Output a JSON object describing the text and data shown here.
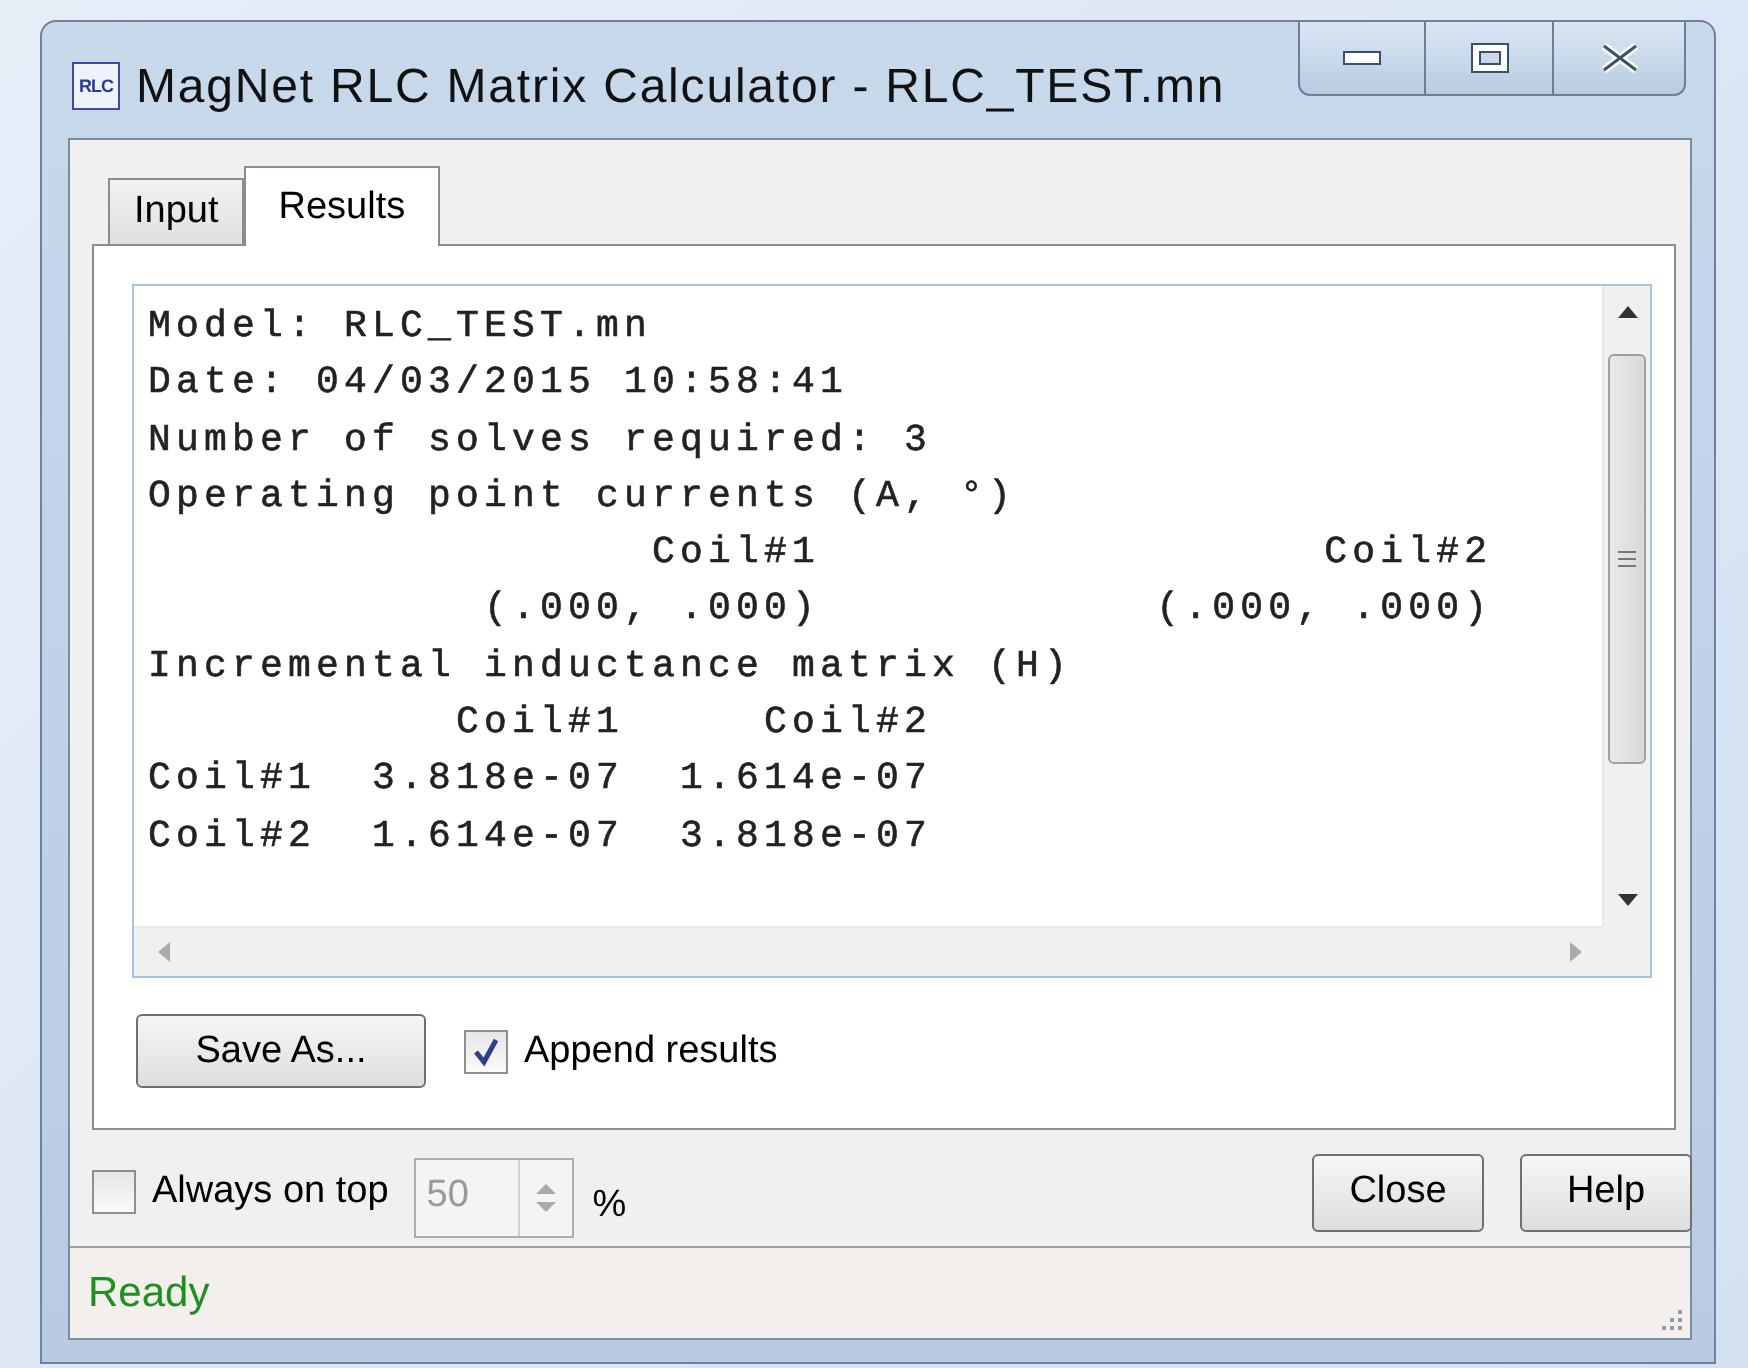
{
  "window": {
    "title": "MagNet RLC Matrix Calculator - RLC_TEST.mn",
    "icon_text": "RLC"
  },
  "tabs": [
    {
      "label": "Input",
      "selected": false
    },
    {
      "label": "Results",
      "selected": true
    }
  ],
  "results": {
    "lines": [
      "Model: RLC_TEST.mn",
      "Date: 04/03/2015 10:58:41",
      "Number of solves required: 3",
      "Operating point currents (A, °)",
      "                  Coil#1                  Coil#2",
      "            (.000, .000)            (.000, .000)",
      "Incremental inductance matrix (H)",
      "           Coil#1     Coil#2",
      "Coil#1  3.818e-07  1.614e-07",
      "Coil#2  1.614e-07  3.818e-07"
    ]
  },
  "save_button": "Save As...",
  "append_results": {
    "label": "Append results",
    "checked": true
  },
  "always_on_top": {
    "label": "Always on top",
    "checked": false
  },
  "opacity": {
    "value": "50",
    "unit": "%",
    "disabled": true
  },
  "buttons": [
    "Close",
    "Help"
  ],
  "status_bar": {
    "text": "Ready"
  }
}
